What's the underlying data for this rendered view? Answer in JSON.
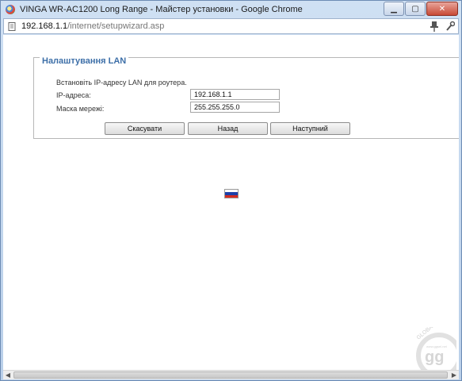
{
  "window": {
    "title": "VINGA WR-AC1200 Long Range - Майстер установки - Google Chrome",
    "controls": {
      "minimize": "▁",
      "maximize": "▢",
      "close": "✕"
    }
  },
  "address": {
    "host": "192.168.1.1",
    "path": "/internet/setupwizard.asp"
  },
  "lan": {
    "legend": "Налаштування LAN",
    "instruction": "Встановіть IP-адресу LAN для роутера.",
    "ip_label": "IP-адреса:",
    "ip_value": "192.168.1.1",
    "mask_label": "Маска мережі:",
    "mask_value": "255.255.255.0"
  },
  "buttons": {
    "cancel": "Скасувати",
    "back": "Назад",
    "next": "Наступний"
  },
  "flag": {
    "stripes": [
      "#ffffff",
      "#1c3fa8",
      "#d52b1e"
    ]
  },
  "watermark": {
    "text": "GLOBAL",
    "logo": "gg",
    "site": "www.ggsel.net"
  },
  "colors": {
    "legend": "#3d6fa8",
    "frame": "#6d8cb4"
  }
}
